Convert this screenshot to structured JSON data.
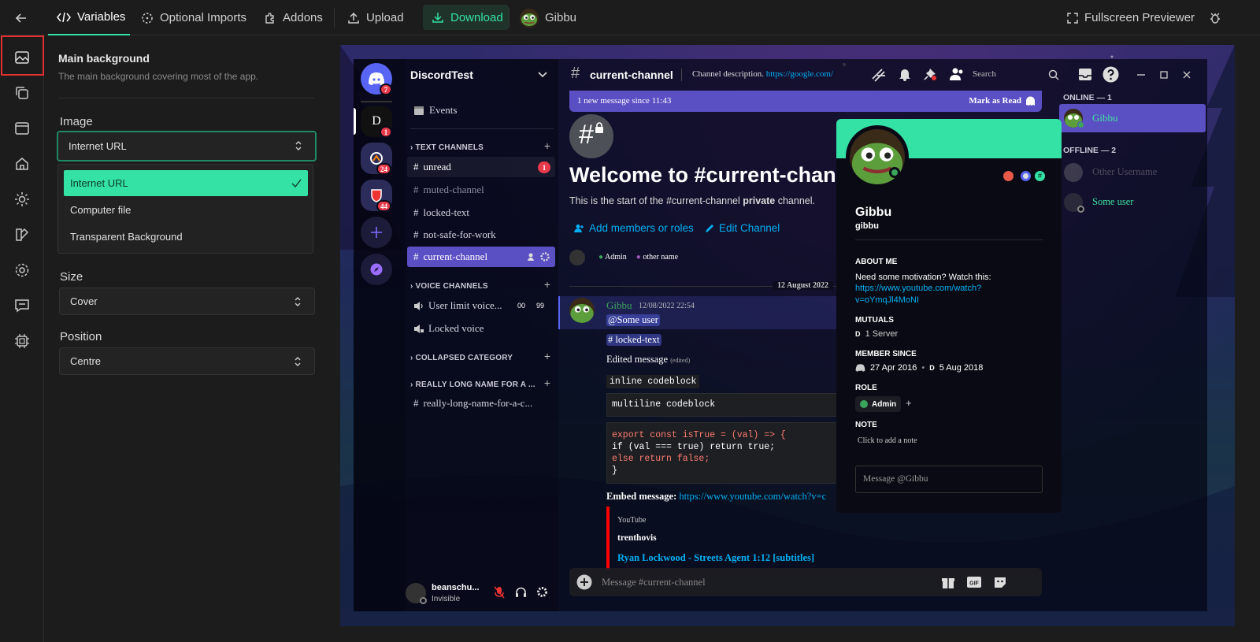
{
  "topbar": {
    "tab_variables": "Variables",
    "tab_optional_imports": "Optional Imports",
    "tab_addons": "Addons",
    "upload": "Upload",
    "download": "Download",
    "theme_name": "Gibbu",
    "fullscreen": "Fullscreen Previewer"
  },
  "panel": {
    "section_title": "Main background",
    "section_desc": "The main background covering most of the app.",
    "image_label": "Image",
    "image_value": "Internet URL",
    "image_options": [
      "Internet URL",
      "Computer file",
      "Transparent Background"
    ],
    "size_label": "Size",
    "size_value": "Cover",
    "position_label": "Position",
    "position_value": "Centre"
  },
  "discord": {
    "server_name": "DiscordTest",
    "guild_badges": [
      "7",
      "1",
      "24",
      "44"
    ],
    "guild_letter": "D",
    "events": "Events",
    "text_channels": "TEXT CHANNELS",
    "channels": [
      "unread",
      "muted-channel",
      "locked-text",
      "not-safe-for-work",
      "current-channel"
    ],
    "unread_badge": "1",
    "voice_channels": "VOICE CHANNELS",
    "voice": [
      "User limit voice...",
      "Locked voice"
    ],
    "voice_counts": [
      "00",
      "99"
    ],
    "collapsed_category": "COLLAPSED CATEGORY",
    "long_category": "REALLY LONG NAME FOR A ...",
    "long_channel": "really-long-name-for-a-c...",
    "user_name": "beanschu...",
    "user_status": "Invisible",
    "header_channel": "current-channel",
    "header_desc": "Channel description.",
    "header_link": "https://google.com/",
    "search_placeholder": "Search",
    "new_msgs": "1 new message since 11:43",
    "mark_read": "Mark as Read",
    "welcome": "Welcome to #current-chann",
    "welcome_sub_1": "This is the start of the #current-channel ",
    "welcome_sub_bold": "private",
    "welcome_sub_2": " channel.",
    "add_members": "Add members or roles",
    "edit_channel": "Edit Channel",
    "role_admin": "Admin",
    "role_other": "other name",
    "date_divider": "12 August 2022",
    "msg_author": "Gibbu",
    "msg_time": "12/08/2022 22:54",
    "mention_user": "@Some user",
    "mention_channel": "locked-text",
    "edited_msg": "Edited message",
    "edited_tag": "(edited)",
    "inline_code": "inline codeblock",
    "multiline_code": "multiline codeblock",
    "code_lines": [
      "export const isTrue = (val) => {",
      "if (val === true) return true;",
      "else return false;",
      "}"
    ],
    "embed_label": "Embed message:",
    "embed_link": "https://www.youtube.com/watch?v=c",
    "embed_provider": "YouTube",
    "embed_author": "trenthovis",
    "embed_title": "Ryan Lockwood - Streets Agent 1:12 [subtitles]",
    "composer_placeholder": "Message #current-channel",
    "online_hdr": "ONLINE — 1",
    "offline_hdr": "OFFLINE — 2",
    "member_online": "Gibbu",
    "member_off1": "Other Username",
    "member_off2": "Some user",
    "profile": {
      "name": "Gibbu",
      "tag": "gibbu",
      "about_hdr": "ABOUT ME",
      "about_text": "Need some motivation? Watch this:",
      "about_link_1": "https://www.youtube.com/watch?",
      "about_link_2": "v=oYmqJl4MoNI",
      "mutuals_hdr": "MUTUALS",
      "mutuals": "1 Server",
      "since_hdr": "MEMBER SINCE",
      "since_discord": "27 Apr 2016",
      "since_server": "5 Aug 2018",
      "role_hdr": "ROLE",
      "role": "Admin",
      "note_hdr": "NOTE",
      "note_ph": "Click to add a note",
      "msg_ph": "Message @Gibbu"
    }
  },
  "colors": {
    "accent": "#34e2a6",
    "active_border": "#e03030",
    "mention": "#5865f2",
    "danger": "#e8394a"
  }
}
